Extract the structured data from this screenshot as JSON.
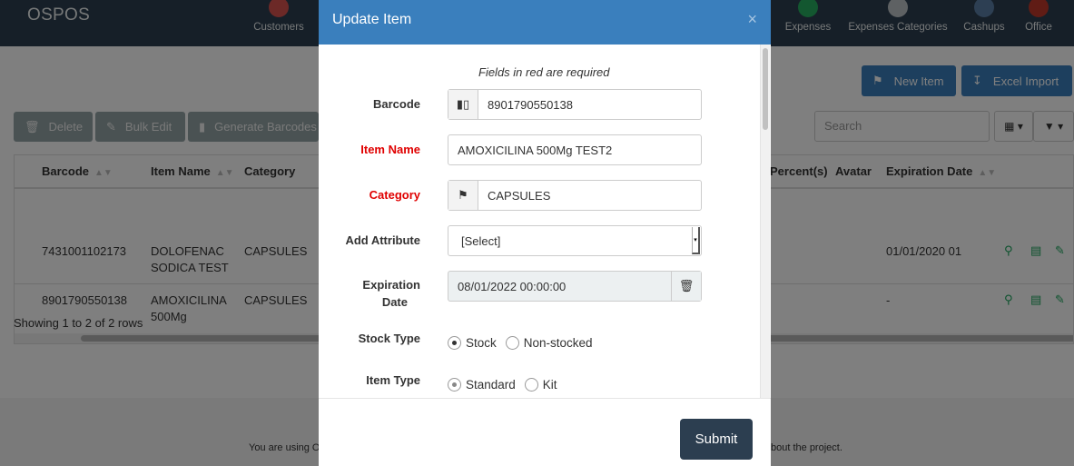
{
  "app": {
    "brand": "OSPOS"
  },
  "nav": [
    {
      "label": "Customers",
      "icon": "customers-icon",
      "color": "#d9534f"
    },
    {
      "label": "Expenses",
      "icon": "expenses-icon",
      "color": "#27ae60"
    },
    {
      "label": "Expenses Categories",
      "icon": "expenses-categories-icon",
      "color": "#bdc3c7"
    },
    {
      "label": "Cashups",
      "icon": "cashups-icon",
      "color": "#5b7fa6"
    },
    {
      "label": "Office",
      "icon": "office-icon",
      "color": "#c0392b"
    }
  ],
  "toolbar": {
    "new_item": "New Item",
    "excel_import": "Excel Import",
    "delete": "Delete",
    "bulk_edit": "Bulk Edit",
    "generate_barcodes": "Generate Barcodes",
    "search_placeholder": "Search"
  },
  "table": {
    "headers": {
      "barcode": "Barcode",
      "item_name": "Item Name",
      "category": "Category",
      "percent": "Percent(s)",
      "avatar": "Avatar",
      "expiration_date": "Expiration Date"
    },
    "rows": [
      {
        "barcode": "7431001102173",
        "item_name": "DOLOFENAC SODICA TEST",
        "category": "CAPSULES",
        "expiration_date": "01/01/2020 01"
      },
      {
        "barcode": "8901790550138",
        "item_name": "AMOXICILINA 500Mg",
        "category": "CAPSULES",
        "expiration_date": "-"
      }
    ],
    "showing": "Showing 1 to 2 of 2 rows"
  },
  "footer": {
    "left": "You are using O",
    "right": "bout the project."
  },
  "modal": {
    "title": "Update Item",
    "close": "×",
    "required_note": "Fields in red are required",
    "fields": {
      "barcode_label": "Barcode",
      "barcode_value": "8901790550138",
      "item_name_label": "Item Name",
      "item_name_value": "AMOXICILINA 500Mg TEST2",
      "category_label": "Category",
      "category_value": "CAPSULES",
      "attribute_label": "Add Attribute",
      "attribute_value": "[Select]",
      "expiration_label_1": "Expiration",
      "expiration_label_2": "Date",
      "expiration_value": "08/01/2022 00:00:00",
      "stock_type_label": "Stock Type",
      "stock_option": "Stock",
      "non_stocked_option": "Non-stocked",
      "item_type_label": "Item Type",
      "standard_option": "Standard",
      "kit_option": "Kit"
    },
    "submit": "Submit"
  }
}
